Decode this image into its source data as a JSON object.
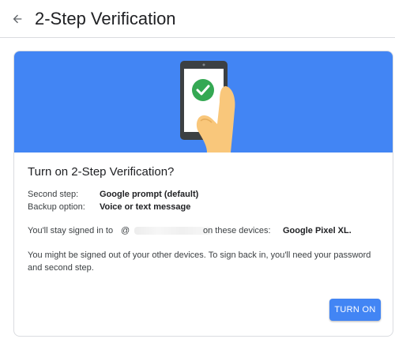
{
  "header": {
    "back_icon": "arrow-back-icon",
    "title": "2-Step Verification"
  },
  "card": {
    "banner": {
      "background_color": "#4285f4",
      "illustration": "phone-with-checkmark-in-hand",
      "check_color": "#34a853",
      "hand_color": "#f9c77b"
    },
    "title": "Turn on 2-Step Verification?",
    "second_step_label": "Second step:",
    "second_step_value": "Google prompt (default)",
    "backup_label": "Backup option:",
    "backup_value": "Voice or text message",
    "signed_in_prefix": "You'll stay signed in to",
    "signed_in_at": "@",
    "signed_in_mid": "on these devices:",
    "signed_in_device": "Google Pixel XL.",
    "signout_notice": "You might be signed out of your other devices. To sign back in, you'll need your password and second step.",
    "turn_on_label": "TURN ON",
    "accent_color": "#4285f4"
  }
}
